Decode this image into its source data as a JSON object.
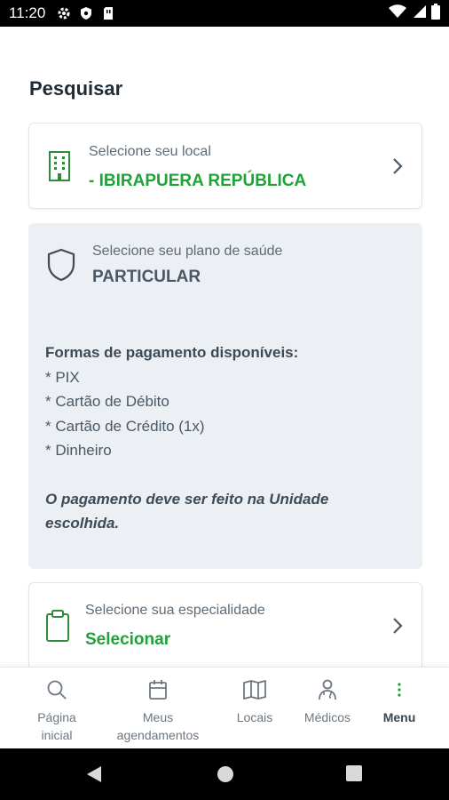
{
  "status_bar": {
    "time": "11:20"
  },
  "page": {
    "title": "Pesquisar"
  },
  "location_card": {
    "label": "Selecione seu local",
    "value": "- IBIRAPUERA REPÚBLICA",
    "icon": "building-icon"
  },
  "plan_card": {
    "label": "Selecione seu plano de saúde",
    "value": "PARTICULAR",
    "icon": "shield-icon",
    "payments_title": "Formas de pagamento disponíveis:",
    "payment_methods": [
      "* PIX",
      "* Cartão de Débito",
      "* Cartão de Crédito (1x)",
      "* Dinheiro"
    ],
    "note_line1": "O pagamento deve ser feito na Unidade",
    "note_line2": "escolhida."
  },
  "specialty_card": {
    "label": "Selecione sua especialidade",
    "value": "Selecionar",
    "icon": "clipboard-icon"
  },
  "bottom_nav": {
    "items": [
      {
        "line1": "Página",
        "line2": "inicial",
        "icon": "search-icon"
      },
      {
        "line1": "Meus",
        "line2": "agendamentos",
        "icon": "calendar-icon"
      },
      {
        "line1": "Locais",
        "line2": "",
        "icon": "map-icon"
      },
      {
        "line1": "Médicos",
        "line2": "",
        "icon": "doctor-icon"
      },
      {
        "line1": "Menu",
        "line2": "",
        "icon": "more-vertical-icon"
      }
    ]
  },
  "colors": {
    "accent_green": "#1fa338",
    "text_slate": "#4a5866",
    "grey_card": "#eceff3"
  }
}
